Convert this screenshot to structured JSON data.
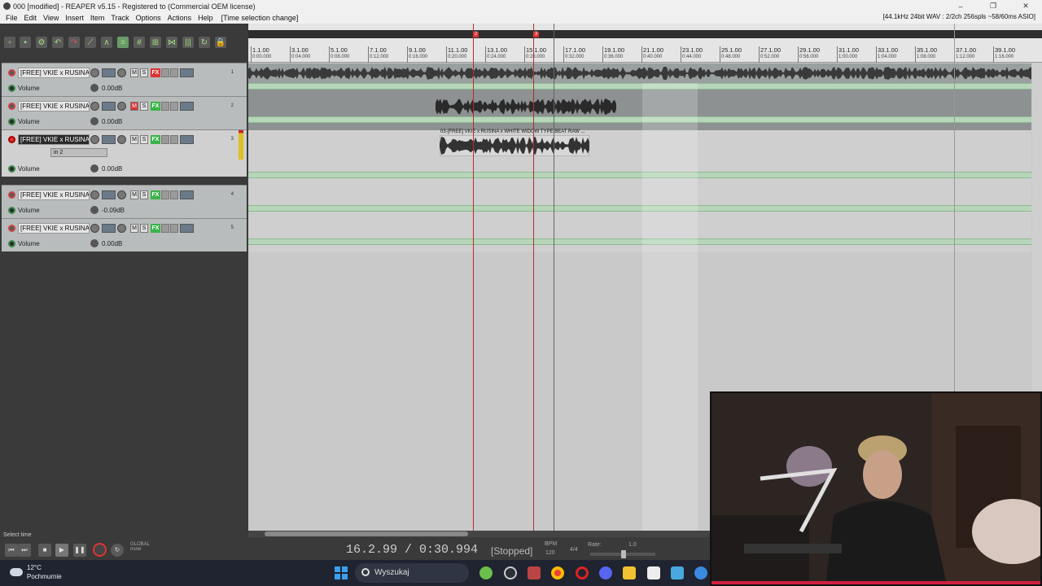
{
  "window": {
    "title": "000 [modified] - REAPER v5.15 - Registered to  (Commercial OEM license)",
    "controls": [
      "–",
      "❐",
      "✕"
    ]
  },
  "menu": {
    "items": [
      "File",
      "Edit",
      "View",
      "Insert",
      "Item",
      "Track",
      "Options",
      "Actions",
      "Help"
    ],
    "status": "[Time selection change]",
    "audio_info": "[44.1kHz 24bit WAV : 2/2ch 256spls ~58/60ms ASIO]"
  },
  "toolbar": {
    "icons": [
      "new-project-icon",
      "save-icon",
      "project-settings-icon",
      "undo-icon",
      "redo-icon",
      "metronome-icon",
      "snap-icon",
      "ripple-icon",
      "grid-icon",
      "envelope-lock-icon",
      "loop-icon",
      "lock-icon"
    ]
  },
  "tracks": [
    {
      "name": "[FREE] VKIE x RUSINA x V",
      "num": "1",
      "mute": false,
      "fx_state": "red",
      "env_label": "Volume",
      "env_value": "0.00dB"
    },
    {
      "name": "[FREE] VKIE x RUSINA x V",
      "num": "2",
      "mute": true,
      "fx_state": "green",
      "env_label": "Volume",
      "env_value": "0.00dB"
    },
    {
      "name": "[FREE] VKIE x RUSINA x V",
      "num": "3",
      "mute": false,
      "fx_state": "green",
      "input": "in 2",
      "env_label": "Volume",
      "env_value": "0.00dB"
    },
    {
      "name": "[FREE] VKIE x RUSINA x V",
      "num": "4",
      "mute": false,
      "fx_state": "green",
      "env_label": "Volume",
      "env_value": "-0.09dB"
    },
    {
      "name": "[FREE] VKIE x RUSINA x V",
      "num": "5",
      "mute": false,
      "fx_state": "green",
      "env_label": "Volume",
      "env_value": "0.00dB"
    }
  ],
  "button_labels": {
    "mute": "M",
    "solo": "S",
    "fx": "FX",
    "trim": "trim"
  },
  "ruler": {
    "bars": [
      "1.1.00",
      "3.1.00",
      "5.1.00",
      "7.1.00",
      "9.1.00",
      "11.1.00",
      "13.1.00",
      "15.1.00",
      "17.1.00",
      "19.1.00",
      "21.1.00",
      "23.1.00",
      "25.1.00",
      "27.1.00",
      "29.1.00",
      "31.1.00",
      "33.1.00",
      "35.1.00",
      "37.1.00",
      "39.1.00"
    ],
    "times": [
      "0:00.000",
      "0:04.000",
      "0:08.000",
      "0:12.000",
      "0:16.000",
      "0:20.000",
      "0:24.000",
      "0:28.000",
      "0:32.000",
      "0:36.000",
      "0:40.000",
      "0:44.000",
      "0:48.000",
      "0:52.000",
      "0:56.000",
      "1:00.000",
      "1:04.000",
      "1:08.000",
      "1:12.000",
      "1:16.000"
    ],
    "markers": [
      "2",
      "3"
    ]
  },
  "media_item_label": "03-[FREE] VKIE x RUSINA x WHITE WIDOW TYPE BEAT  RAW ...",
  "transport": {
    "left_label": "Select time",
    "position": "16.2.99 / 0:30.994",
    "state": "[Stopped]",
    "bpm_label": "BPM",
    "bpm_value": "120",
    "time_sig": "4/4",
    "rate_label": "Rate:",
    "rate_value": "1.0",
    "global_label": "GLOBAL",
    "global_sub": "none"
  },
  "taskbar": {
    "temperature": "12°C",
    "weather": "Pochmurnie",
    "search_placeholder": "Wyszukaj"
  }
}
